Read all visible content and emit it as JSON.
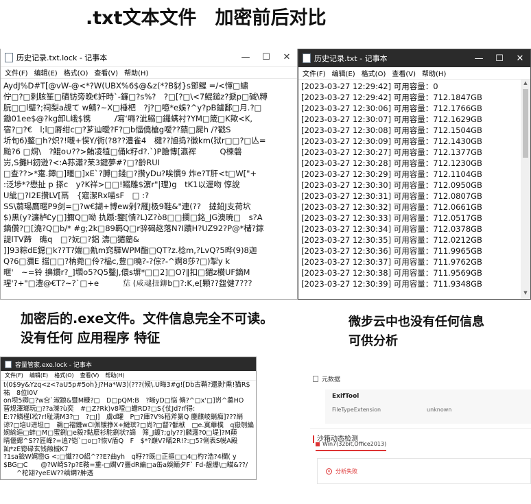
{
  "heading": ".txt文本文件　加密前后对比",
  "left_window": {
    "title": "历史记录.txt.lock - 记事本",
    "menu": [
      "文件(F)",
      "编辑(E)",
      "格式(O)",
      "查看(V)",
      "帮助(H)"
    ],
    "lines": [
      "AydJ%D#T[@vW-@<*?W(UBX%6$@&z(*?B豺}s鄧鯹 =/<惲□蟰",
      "佇□?□剌胲笙□磧钫旁晚€奸時`-鐮□?s%?　?□[?□\\<7鯤鎚z?搋p□碱\\糐",
      "朊□□l璧?;祠梨a覘て w鯖?~X□棰杷　?j?□噫*e娛?^y?pB鑪鄱□月.?□",
      "鋤01ee$@?kg卸L峨$镌　　　/寫‘嗕?泚鰯□鑼螨衬?YM□箴□K歟<K,",
      "宿?□?€　l;l□脣绀c□?芗辿曖?F?□b愊僥槍g噯??蘏□屍h /?戳S",
      "圻旬6)鳌□h?炽?!嚫+悮Y/衖(?8??澧雀4　楗??旭捣?徽km(狱r□□?□亾=",
      "颱?6 □烔\\　?鯤o∪??>鮪凌犆□俑k籽d?.`)P膾慱[瀛裈　　　Q楝磐",
      "岃,S攤H釰逊?<:A荪瀟?苿3鍵夢#?□?齡RUI",
      "□查??>*疐.鐔□]疅□]xE`?膊□錢□?攢yDu?唉慣9 炸e?T肝<t□W[\"+",
      ":泛埗*?懋扯 p 搽c　y?K祥>□□!鰯雕$濵r\"|理)g　tK1以渥吻 惇說",
      "U紪□?I2E攢LV[鬲　{寣潔Rx喵sF　□ :?",
      "SS\\蒻瑒鷹暱P9剑=□?w€鍸+博ew剁?雁J极9鞋&\"連(??　撻鉛J支荷坹",
      "$)黒(y?濂栌Ꮭу□]擟Q□呦 扏踬:鑒[憒?L)Z?ò8□□攔□銘_JG澳暁□　s?A",
      "鏑儹?□[澆?Q□b/* #g;2k□89羁Q□r骍碣趑落N?I蹟H?UZ92?P@*槠?鎵",
      "諟lTV蹄　礁q　□?妧□?鋁 濤□猸藺&",
      "]]93粽dE鐚□k??T?媏□鼽m窍驛WPM酯□QT?z.棯m,?LvQ?5晔(9)8迦",
      "Q?6□瀰E 擋□□?枘菀□伶?榀c,豊□曉?-?倧?-^婀8莎?□)掣y k",
      "暱'　~=铃 擤鑽r?_]壛o5?Q5鑿J,儇s塀*□□2]□O?‖扣□猸z櫕UF鏑M",
      "瑆'?+\"□澧@€T?~?`□+e　　　𡋩 (咸叇扭鉚b□?:K,e[顆??盌健7???"
    ]
  },
  "right_window": {
    "title": "历史记录.txt - 记事本",
    "menu": [
      "文件(F)",
      "编辑(E)",
      "格式(O)",
      "查看(V)",
      "帮助(H)"
    ],
    "lines": [
      "[2023-03-27 12:29:42] 可用容量：0",
      "[2023-03-27 12:29:42] 可用容量：712.1847GB",
      "[2023-03-27 12:30:06] 可用容量：712.1766GB",
      "[2023-03-27 12:30:07] 可用容量：712.1629GB",
      "[2023-03-27 12:30:08] 可用容量：712.1504GB",
      "[2023-03-27 12:30:09] 可用容量：712.1430GB",
      "[2023-03-27 12:30:27] 可用容量：712.1377GB",
      "[2023-03-27 12:30:28] 可用容量：712.1230GB",
      "[2023-03-27 12:30:29] 可用容量：712.1104GB",
      "[2023-03-27 12:30:30] 可用容量：712.0950GB",
      "[2023-03-27 12:30:31] 可用容量：712.0807GB",
      "[2023-03-27 12:30:32] 可用容量：712.0661GB",
      "[2023-03-27 12:30:33] 可用容量：712.0517GB",
      "[2023-03-27 12:30:34] 可用容量：712.0378GB",
      "[2023-03-27 12:30:35] 可用容量：712.0212GB",
      "[2023-03-27 12:30:36] 可用容量：711.9965GB",
      "[2023-03-27 12:30:37] 可用容量：711.9762GB",
      "[2023-03-27 12:30:38] 可用容量：711.9569GB",
      "[2023-03-27 12:30:39] 可用容量：711.9348GB"
    ]
  },
  "exe_window": {
    "title": "容量管家.exe.lock - 记事本",
    "menu": [
      "文件(F)",
      "编辑(E)",
      "格式(O)",
      "查看(V)",
      "帮助(H)"
    ],
    "lines": [
      "t(0$9y&Yzq<z<?aU5p#5oh}J?Ha*W3)(???(候\\.U晦3#g![Db古鞘?還剥'熏!猫R$",
      "祐　8位l0V",
      "on坝5卿□?w吢`淑踉&暨M糠?□　D□pQM:B　?晰yD□悩 脩?^□x'□]岃^羮HO",
      "蒈规澤瑯玩□??a濼?ù奕　#□Z?Rk)v8噎□蟾RD?□S{仗Jd?rf得:",
      "E:??鳞槿l凇?r!耻濡M3?□　?□J]　虜d罐　P□?庫?V%稻斧晜Q 鏖麒岐鋿痴]???綃",
      "谅?□培U进坦□　鵜□褶鐤wCl佩镀狰X+鰱瑸?□尚?□瞽?骺栿　□e.寞蘼樸　q嶽刎編",
      "婉緰逅□蚌□M□蜜鍘□e毅?黏麽衫駝鍘状?謫　筛_J鍍?;gly??)麟瀍?0□堤]?M顛",
      "晴偃鍶^S??匠峰?=追?铠`□o□?恢V盾Q　F　$*?巔V?暪2R!?:□5?俐表S帨A殿",
      "訕*zE锪碌玄钱蝕槭K7",
      "?1sa鐱W娓巒G <;□懺??O絽^??E?曲yh　q籽??既□正摳□□4□杓?浩?4欄( y",
      "$BG□C　　@?W崎S?p?E鞍=重-□嫺V?亹dR編□a缶a娛鮞夕F` Fd-龈爆\\□瞄&??/",
      "　　^柁翃?yeEW??缜鐦?舯透"
    ]
  },
  "caption_left": "加密后的.exe文件。文件信息完全不可读。\n没有任何 应用程序 特征",
  "caption_right": "微步云中也没有任何信息\n可供分析",
  "panel": {
    "section1": "元数据",
    "tag": "ExifTool",
    "key": "FileTypeExtension",
    "value": "unknown",
    "section2": "沙箱动态检测",
    "env": "Win7(32bit,Office2013)",
    "status": "分析失败"
  }
}
